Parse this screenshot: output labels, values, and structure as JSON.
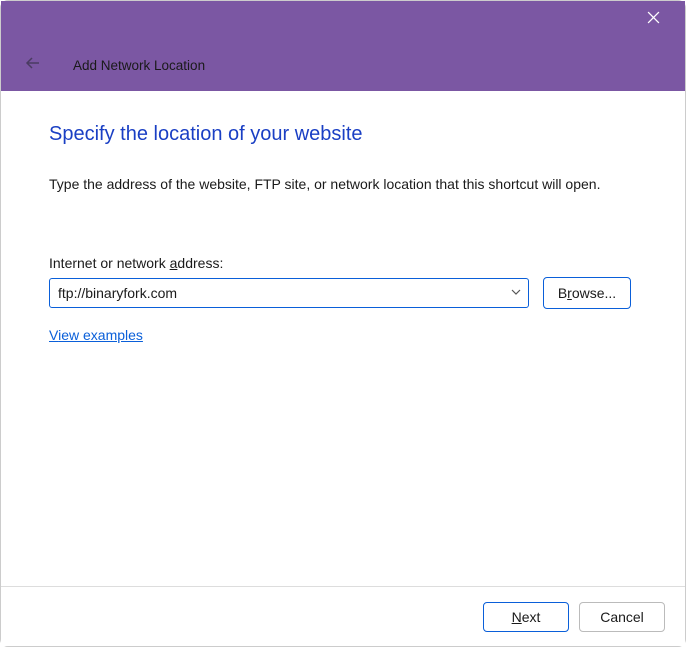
{
  "header": {
    "wizard_title": "Add Network Location"
  },
  "page": {
    "heading": "Specify the location of your website",
    "instruction": "Type the address of the website, FTP site, or network location that this shortcut will open."
  },
  "form": {
    "address_label_pre": "Internet or network ",
    "address_label_u": "a",
    "address_label_post": "ddress:",
    "address_value": "ftp://binaryfork.com",
    "browse_pre": "B",
    "browse_u": "r",
    "browse_post": "owse...",
    "examples_pre": "",
    "examples_u": "V",
    "examples_post": "iew examples"
  },
  "footer": {
    "next_u": "N",
    "next_post": "ext",
    "cancel": "Cancel"
  }
}
